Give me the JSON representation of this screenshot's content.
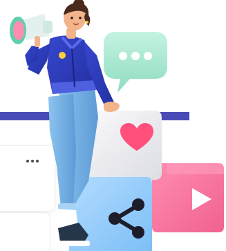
{
  "illustration": {
    "description_icons": [
      "megaphone-icon",
      "chat-bubble-icon",
      "heart-icon",
      "share-icon",
      "play-icon",
      "more-icon"
    ]
  },
  "colors": {
    "accent_band": "#4a4bb6",
    "chat_bubble": "#a7e8d0",
    "heart_cube": "#f4f3f6",
    "heart": "#ff4f7a",
    "share_cube": "#9fd4ff",
    "play_cube": "#ff7fa3",
    "jacket": "#2f3fc1",
    "jeans": "#7db6e8",
    "skin": "#f2b48a",
    "hair": "#4a2a1c",
    "megaphone": "#e8f4f1"
  }
}
